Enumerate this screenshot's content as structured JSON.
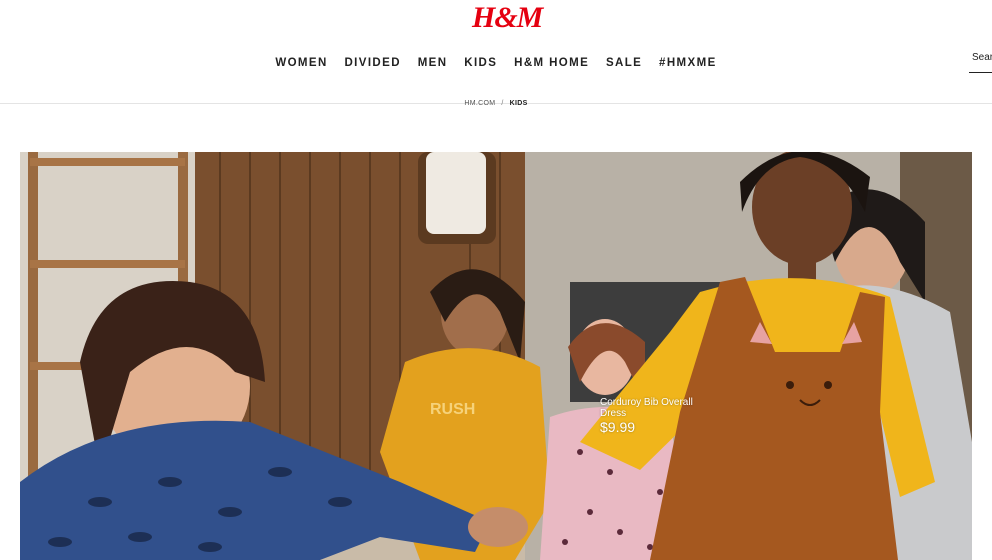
{
  "header": {
    "logo_text": "H&M",
    "brand_color": "#e50010",
    "nav": [
      "WOMEN",
      "DIVIDED",
      "MEN",
      "KIDS",
      "H&M HOME",
      "SALE",
      "#HMXME"
    ],
    "search_placeholder": "Search"
  },
  "breadcrumb": {
    "home": "HM.COM",
    "separator": "/",
    "current": "KIDS"
  },
  "hero": {
    "image": "kids-running-hero-photo",
    "product_tag": {
      "name": "Corduroy Bib Overall Dress",
      "price": "$9.99"
    }
  }
}
